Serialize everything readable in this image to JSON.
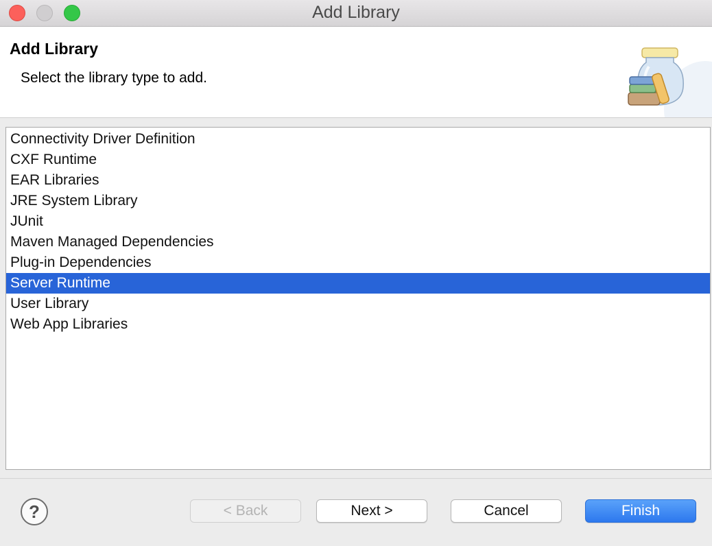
{
  "window": {
    "title": "Add Library"
  },
  "header": {
    "title": "Add Library",
    "subtitle": "Select the library type to add.",
    "icon": "library-jar-icon"
  },
  "library_types": {
    "items": [
      "Connectivity Driver Definition",
      "CXF Runtime",
      "EAR Libraries",
      "JRE System Library",
      "JUnit",
      "Maven Managed Dependencies",
      "Plug-in Dependencies",
      "Server Runtime",
      "User Library",
      "Web App Libraries"
    ],
    "selected": "Server Runtime"
  },
  "footer": {
    "help": "?",
    "back_label": "< Back",
    "next_label": "Next >",
    "cancel_label": "Cancel",
    "finish_label": "Finish"
  },
  "colors": {
    "selection": "#2864d8",
    "finish_button": "#2d78ee",
    "close": "#fc605b",
    "maximize": "#34c748"
  }
}
